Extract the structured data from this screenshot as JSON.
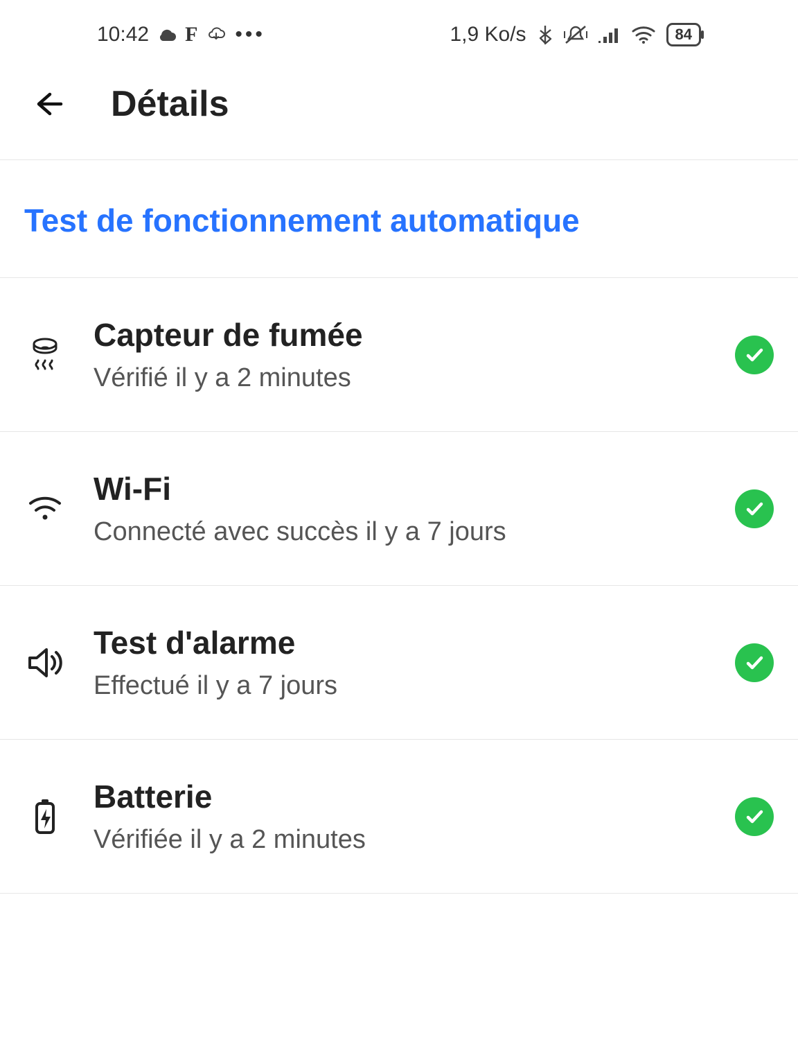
{
  "status": {
    "time": "10:42",
    "data_rate": "1,9 Ko/s",
    "battery_percent": "84"
  },
  "header": {
    "title": "Détails"
  },
  "section": {
    "label": "Test de fonctionnement automatique"
  },
  "items": [
    {
      "icon": "smoke-sensor-icon",
      "title": "Capteur de fumée",
      "subtitle": "Vérifié il y a 2 minutes",
      "status": "ok"
    },
    {
      "icon": "wifi-icon",
      "title": "Wi-Fi",
      "subtitle": "Connecté avec succès il y a 7 jours",
      "status": "ok"
    },
    {
      "icon": "speaker-icon",
      "title": "Test d'alarme",
      "subtitle": "Effectué il y a 7 jours",
      "status": "ok"
    },
    {
      "icon": "battery-icon",
      "title": "Batterie",
      "subtitle": "Vérifiée il y a 2 minutes",
      "status": "ok"
    }
  ],
  "colors": {
    "accent": "#2773ff",
    "ok": "#29c24f"
  }
}
